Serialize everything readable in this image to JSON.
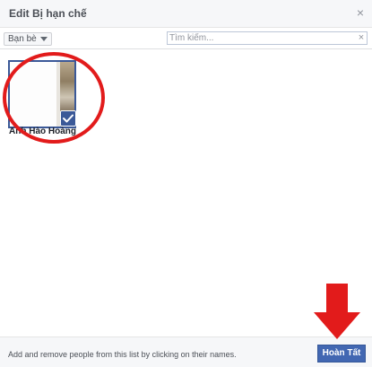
{
  "dialog": {
    "title": "Edit Bị hạn chế",
    "close_glyph": "×"
  },
  "toolbar": {
    "filter_label": "Bạn bè",
    "search_placeholder": "Tìm kiếm...",
    "search_value": "",
    "clear_glyph": "×"
  },
  "friends": [
    {
      "name": "Anh Hào Hoàng",
      "selected": true
    }
  ],
  "footer": {
    "hint": "Add and remove people from this list by clicking on their names.",
    "done_label": "Hoàn Tất"
  },
  "colors": {
    "accent": "#4267b2",
    "annotation_red": "#e21b1b"
  },
  "icons": {
    "close": "close-icon",
    "caret": "chevron-down-icon",
    "check": "checkmark-icon",
    "arrow": "arrow-down-icon"
  }
}
